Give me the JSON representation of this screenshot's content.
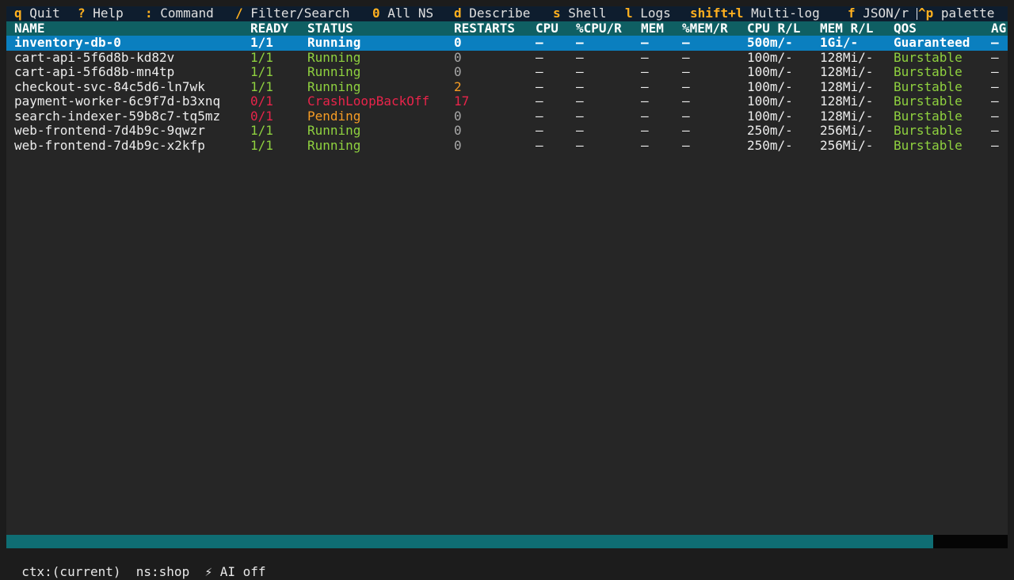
{
  "keybar": [
    {
      "key": "q",
      "label": "Quit"
    },
    {
      "key": "?",
      "label": "Help"
    },
    {
      "key": ":",
      "label": "Command"
    },
    {
      "key": "/",
      "label": "Filter/Search"
    },
    {
      "key": "0",
      "label": "All NS"
    },
    {
      "key": "d",
      "label": "Describe"
    },
    {
      "key": "s",
      "label": "Shell"
    },
    {
      "key": "l",
      "label": "Logs"
    },
    {
      "key": "shift+l",
      "label": "Multi-log"
    },
    {
      "key": "f",
      "label": "JSON/r"
    },
    {
      "key": "^p",
      "label": "palette"
    }
  ],
  "columns": [
    "NAME",
    "READY",
    "STATUS",
    "RESTARTS",
    "CPU",
    "%CPU/R",
    "MEM",
    "%MEM/R",
    "CPU R/L",
    "MEM R/L",
    "QOS",
    "AG"
  ],
  "pods": [
    {
      "name": "inventory-db-0",
      "ready": "1/1",
      "status": "Running",
      "restarts": "0",
      "cpu": "–",
      "cpu_pct": "–",
      "mem": "–",
      "mem_pct": "–",
      "cpu_rl": "500m/-",
      "mem_rl": "1Gi/-",
      "qos": "Guaranteed",
      "age": "–",
      "selected": true,
      "ready_color": "green",
      "status_color": "green",
      "restarts_color": "dim",
      "qos_color": "green"
    },
    {
      "name": "cart-api-5f6d8b-kd82v",
      "ready": "1/1",
      "status": "Running",
      "restarts": "0",
      "cpu": "–",
      "cpu_pct": "–",
      "mem": "–",
      "mem_pct": "–",
      "cpu_rl": "100m/-",
      "mem_rl": "128Mi/-",
      "qos": "Burstable",
      "age": "–",
      "selected": false,
      "ready_color": "green",
      "status_color": "green",
      "restarts_color": "dim",
      "qos_color": "green"
    },
    {
      "name": "cart-api-5f6d8b-mn4tp",
      "ready": "1/1",
      "status": "Running",
      "restarts": "0",
      "cpu": "–",
      "cpu_pct": "–",
      "mem": "–",
      "mem_pct": "–",
      "cpu_rl": "100m/-",
      "mem_rl": "128Mi/-",
      "qos": "Burstable",
      "age": "–",
      "selected": false,
      "ready_color": "green",
      "status_color": "green",
      "restarts_color": "dim",
      "qos_color": "green"
    },
    {
      "name": "checkout-svc-84c5d6-ln7wk",
      "ready": "1/1",
      "status": "Running",
      "restarts": "2",
      "cpu": "–",
      "cpu_pct": "–",
      "mem": "–",
      "mem_pct": "–",
      "cpu_rl": "100m/-",
      "mem_rl": "128Mi/-",
      "qos": "Burstable",
      "age": "–",
      "selected": false,
      "ready_color": "green",
      "status_color": "green",
      "restarts_color": "orange",
      "qos_color": "green"
    },
    {
      "name": "payment-worker-6c9f7d-b3xnq",
      "ready": "0/1",
      "status": "CrashLoopBackOff",
      "restarts": "17",
      "cpu": "–",
      "cpu_pct": "–",
      "mem": "–",
      "mem_pct": "–",
      "cpu_rl": "100m/-",
      "mem_rl": "128Mi/-",
      "qos": "Burstable",
      "age": "–",
      "selected": false,
      "ready_color": "red",
      "status_color": "red",
      "restarts_color": "red",
      "qos_color": "green"
    },
    {
      "name": "search-indexer-59b8c7-tq5mz",
      "ready": "0/1",
      "status": "Pending",
      "restarts": "0",
      "cpu": "–",
      "cpu_pct": "–",
      "mem": "–",
      "mem_pct": "–",
      "cpu_rl": "100m/-",
      "mem_rl": "128Mi/-",
      "qos": "Burstable",
      "age": "–",
      "selected": false,
      "ready_color": "red",
      "status_color": "orange",
      "restarts_color": "dim",
      "qos_color": "green"
    },
    {
      "name": "web-frontend-7d4b9c-9qwzr",
      "ready": "1/1",
      "status": "Running",
      "restarts": "0",
      "cpu": "–",
      "cpu_pct": "–",
      "mem": "–",
      "mem_pct": "–",
      "cpu_rl": "250m/-",
      "mem_rl": "256Mi/-",
      "qos": "Burstable",
      "age": "–",
      "selected": false,
      "ready_color": "green",
      "status_color": "green",
      "restarts_color": "dim",
      "qos_color": "green"
    },
    {
      "name": "web-frontend-7d4b9c-x2kfp",
      "ready": "1/1",
      "status": "Running",
      "restarts": "0",
      "cpu": "–",
      "cpu_pct": "–",
      "mem": "–",
      "mem_pct": "–",
      "cpu_rl": "250m/-",
      "mem_rl": "256Mi/-",
      "qos": "Burstable",
      "age": "–",
      "selected": false,
      "ready_color": "green",
      "status_color": "green",
      "restarts_color": "dim",
      "qos_color": "green"
    }
  ],
  "footer": {
    "ctx": "ctx:(current)",
    "ns": "ns:shop",
    "ai_icon": "lightning-icon",
    "ai_glyph": "⚡",
    "ai": "AI off"
  },
  "colors": {
    "accent_key": "#ffb01f",
    "selected_row": "#0a7fbf",
    "header_bg": "#0f5f63",
    "running": "#8fd13f",
    "error": "#e8244a",
    "warning": "#f59b24"
  }
}
